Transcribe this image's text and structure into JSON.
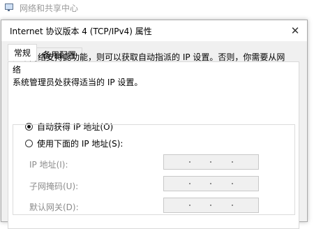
{
  "background_window": {
    "title": "网络和共享中心",
    "icon": "network-monitor-icon"
  },
  "dialog": {
    "title": "Internet 协议版本 4 (TCP/IPv4) 属性",
    "close_glyph": "✕",
    "tabs": [
      {
        "label": "常规",
        "active": true
      },
      {
        "label": "备用配置",
        "active": false
      }
    ],
    "description_line1": "如果网络支持此功能，则可以获取自动指派的 IP 设置。否则，你需要从网络",
    "description_line2": "系统管理员处获得适当的 IP 设置。",
    "radio_auto": {
      "label": "自动获得 IP 地址(O)",
      "checked": true
    },
    "radio_manual": {
      "label": "使用下面的 IP 地址(S):",
      "checked": false
    },
    "fields": [
      {
        "label": "IP 地址(I):",
        "value": ""
      },
      {
        "label": "子网掩码(U):",
        "value": ""
      },
      {
        "label": "默认网关(D):",
        "value": ""
      }
    ]
  },
  "colors": {
    "dialog_bg": "#f0f0f0",
    "disabled_text": "#8c8c8c",
    "border": "#d9d9d9"
  }
}
